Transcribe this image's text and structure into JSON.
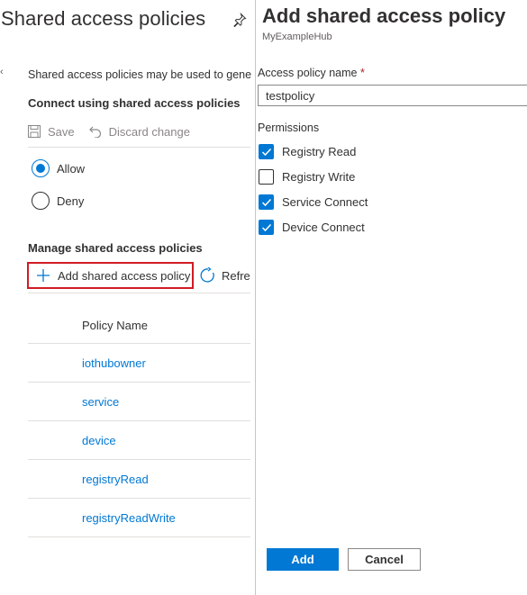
{
  "left_blade": {
    "title": "Shared access policies",
    "description": "Shared access policies may be used to gene",
    "connect_heading": "Connect using shared access policies",
    "toolbar": {
      "save_label": "Save",
      "discard_label": "Discard change"
    },
    "radio_options": [
      {
        "label": "Allow",
        "selected": true
      },
      {
        "label": "Deny",
        "selected": false
      }
    ],
    "manage_heading": "Manage shared access policies",
    "add_policy_label": "Add shared access policy",
    "refresh_label": "Refre",
    "table": {
      "column_header": "Policy Name",
      "rows": [
        "iothubowner",
        "service",
        "device",
        "registryRead",
        "registryReadWrite"
      ]
    }
  },
  "right_panel": {
    "title": "Add shared access policy",
    "subtitle": "MyExampleHub",
    "name_label": "Access policy name",
    "required_marker": "*",
    "name_value": "testpolicy",
    "permissions_label": "Permissions",
    "permissions": [
      {
        "label": "Registry Read",
        "checked": true
      },
      {
        "label": "Registry Write",
        "checked": false
      },
      {
        "label": "Service Connect",
        "checked": true
      },
      {
        "label": "Device Connect",
        "checked": true
      }
    ],
    "add_button": "Add",
    "cancel_button": "Cancel"
  },
  "colors": {
    "accent": "#0078d4",
    "highlight_border": "#d01c24",
    "link": "#0078d4"
  }
}
